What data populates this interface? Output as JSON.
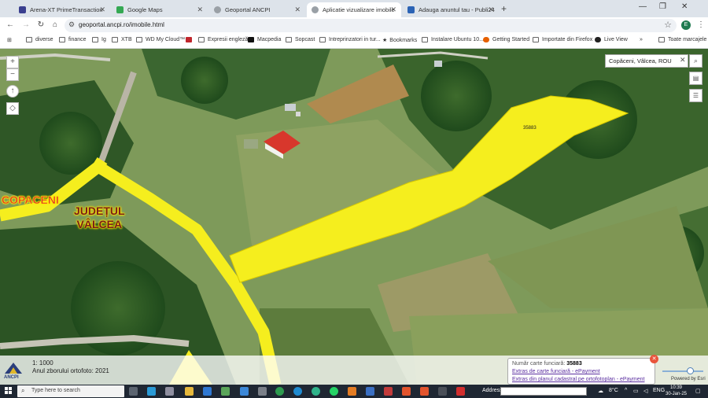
{
  "browser": {
    "tabs": [
      {
        "title": "Arena-XT PrimeTransaction",
        "favicon_color": "#3a3f8f",
        "active": false
      },
      {
        "title": "Google Maps",
        "favicon_color": "#34a853",
        "active": false
      },
      {
        "title": "Geoportal ANCPI",
        "favicon_color": "#9aa0a6",
        "active": false
      },
      {
        "title": "Aplicatie vizualizare imobile",
        "favicon_color": "#9aa0a6",
        "active": true
      },
      {
        "title": "Adauga anuntul tau - Publi24",
        "favicon_color": "#2b63b5",
        "active": false
      }
    ],
    "url": "geoportal.ancpi.ro/imobile.html",
    "profile_initial": "E",
    "bookmarks": [
      "diverse",
      "finance",
      "Ig",
      "XTB",
      "WD My Cloud™",
      "",
      "Expresii engleză",
      "Macpedia",
      "Sopcast",
      "Intreprinzatori in tur...",
      "Bookmarks",
      "Instalare Ubuntu 10....",
      "Getting Started",
      "Importate din Firefox",
      "Live View"
    ],
    "all_bookmarks": "Toate marcajele"
  },
  "map": {
    "search_value": "Copăceni, Vâlcea, ROU",
    "parcel_label": "35883",
    "place_label": "COPACENI",
    "county_label_line1": "JUDEȚUL",
    "county_label_line2": "VÂLCEA",
    "overlay_color": "#f5ee1e",
    "building_roof_color": "#d8372c"
  },
  "status": {
    "logo_text": "ANCPI",
    "scale": "1: 1000",
    "ortho_year": "Anul zborului ortofoto: 2021"
  },
  "info_popup": {
    "cf_label": "Număr carte funciară: ",
    "cf_number": "35883",
    "link1": "Extras de carte funciară - ePayment",
    "link2": "Extras din planul cadastral pe ortofotoplan - ePayment"
  },
  "esri_credit": "Powered by Esri",
  "taskbar": {
    "search_placeholder": "Type here to search",
    "address_label": "Address",
    "temperature": "8°C",
    "language": "ENG",
    "time": "10:39",
    "date": "30-Jan-25"
  }
}
